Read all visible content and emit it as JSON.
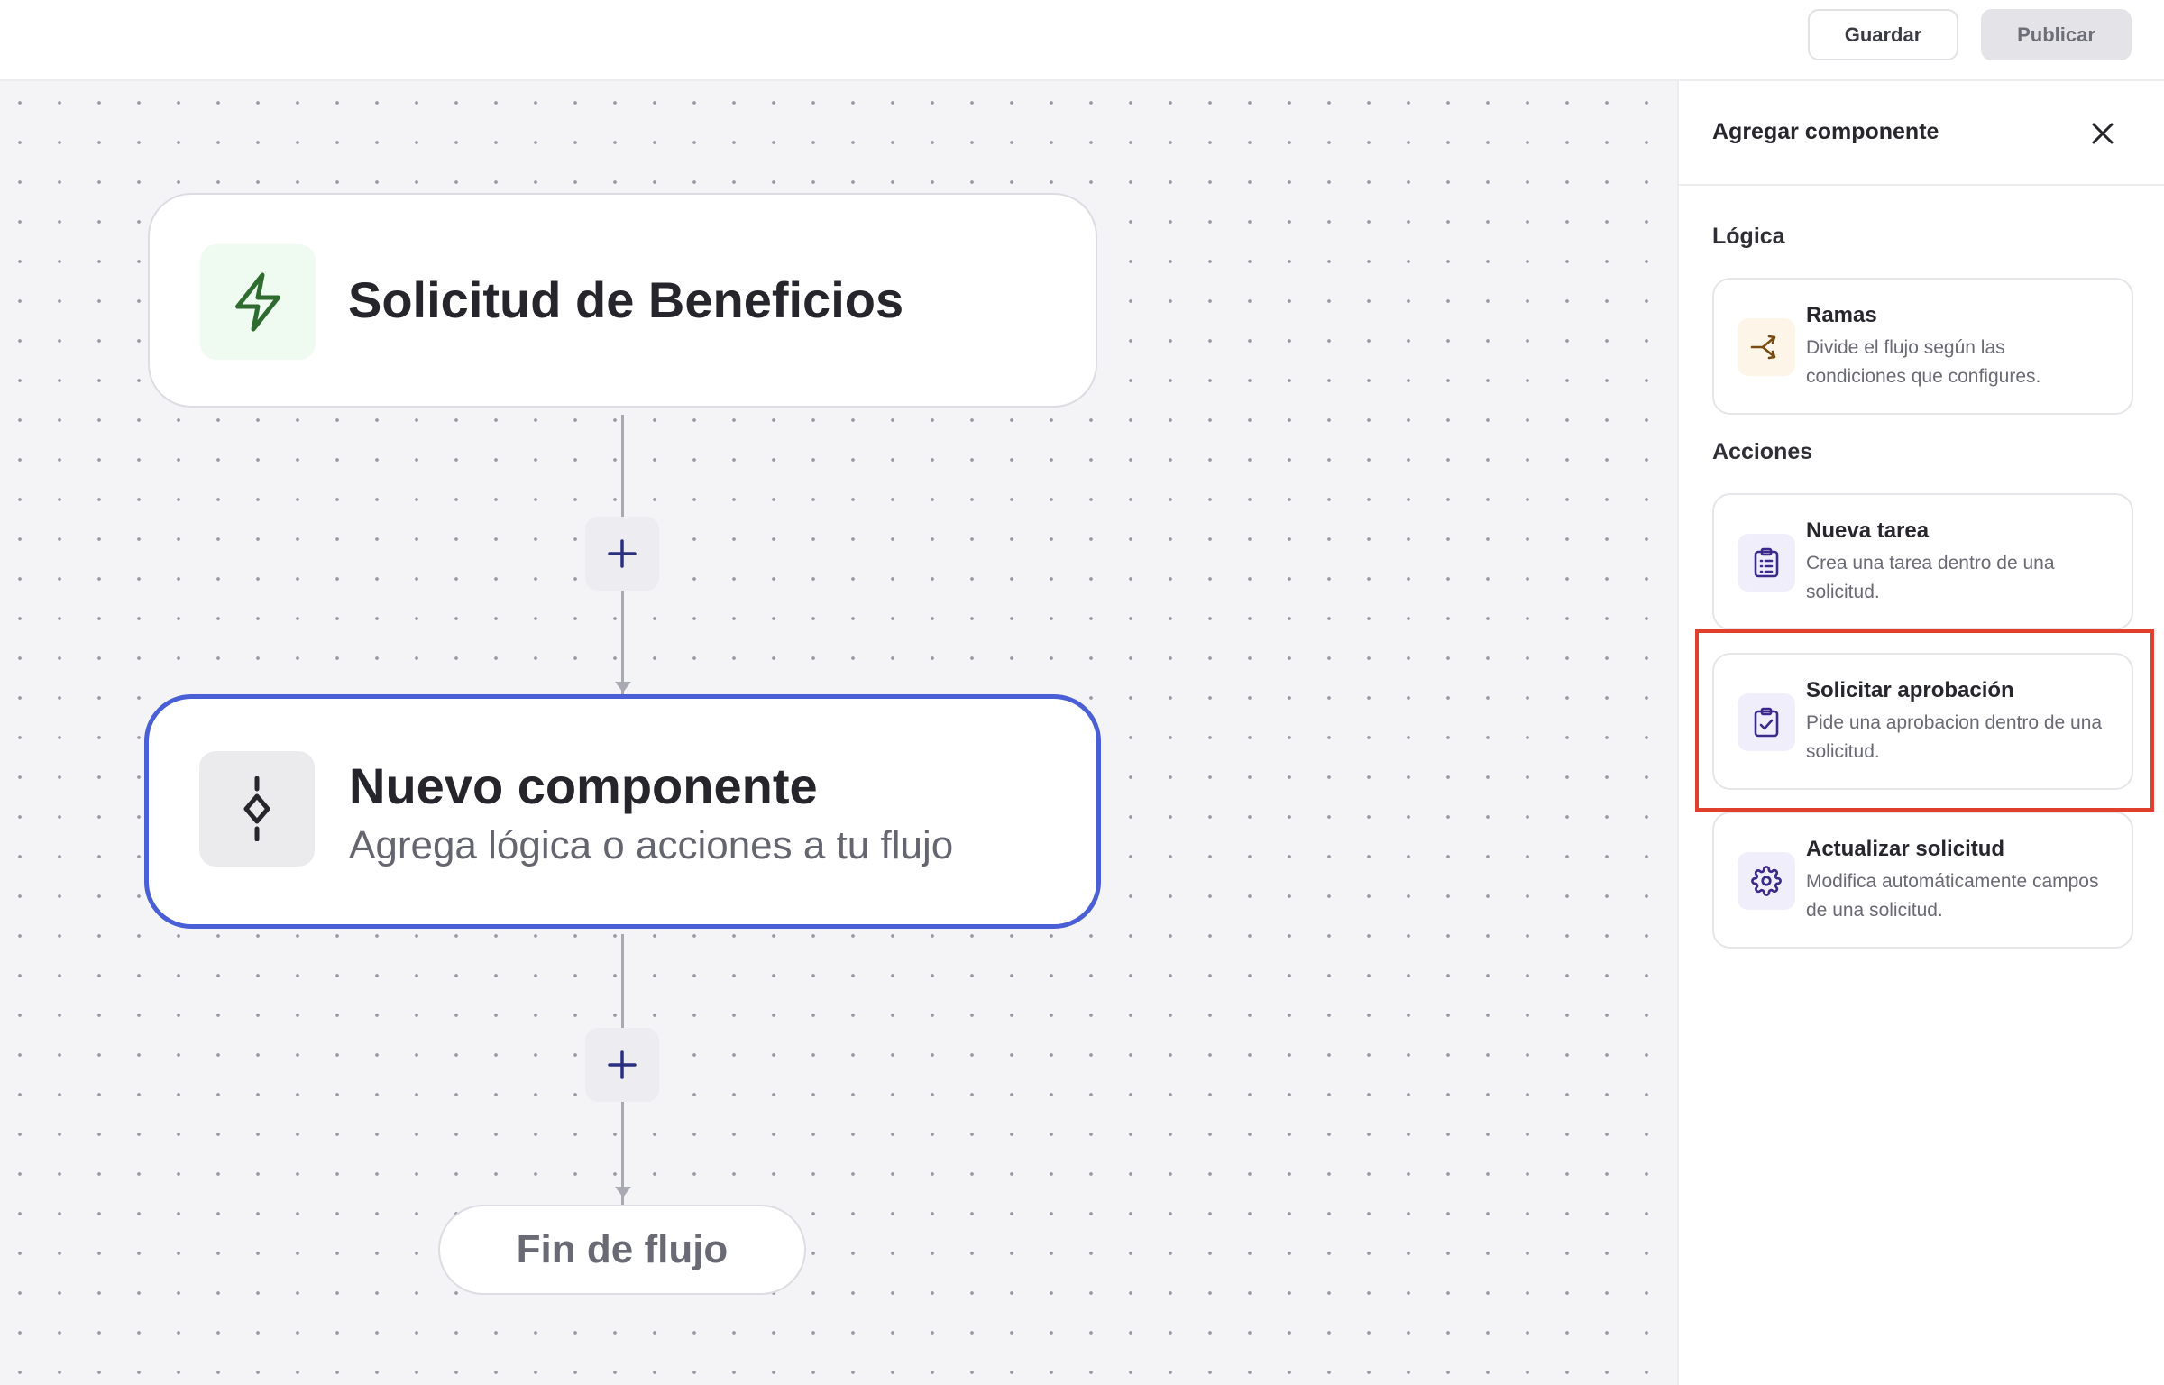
{
  "toolbar": {
    "save_label": "Guardar",
    "publish_label": "Publicar"
  },
  "canvas": {
    "trigger_node": {
      "title": "Solicitud de Beneficios",
      "icon": "lightning-icon"
    },
    "new_node": {
      "title": "Nuevo componente",
      "subtitle": "Agrega lógica o acciones a tu flujo",
      "icon": "diamond-node-icon"
    },
    "end_node": {
      "label": "Fin de flujo"
    },
    "add_step_icon": "plus-icon"
  },
  "panel": {
    "title": "Agregar componente",
    "close_icon": "close-icon",
    "sections": [
      {
        "label": "Lógica",
        "items": [
          {
            "title": "Ramas",
            "description": "Divide el flujo según las condiciones que configures.",
            "icon": "branch-icon",
            "icon_bg": "#fdf5e8",
            "icon_color": "#7a4a12"
          }
        ]
      },
      {
        "label": "Acciones",
        "items": [
          {
            "title": "Nueva tarea",
            "description": "Crea una tarea dentro de una solicitud.",
            "icon": "clipboard-list-icon",
            "icon_bg": "#f1eefb",
            "icon_color": "#3b2a8c"
          },
          {
            "title": "Solicitar aprobación",
            "description": "Pide una aprobacion dentro de una solicitud.",
            "icon": "clipboard-check-icon",
            "icon_bg": "#f1eefb",
            "icon_color": "#3b2a8c",
            "highlighted": true
          },
          {
            "title": "Actualizar solicitud",
            "description": "Modifica automáticamente campos de una solicitud.",
            "icon": "gear-icon",
            "icon_bg": "#f1eefb",
            "icon_color": "#3b2a8c"
          }
        ]
      }
    ]
  },
  "colors": {
    "selected_node_border": "#4a5fd6",
    "highlight_border": "#e0402b",
    "trigger_icon": "#2e6b2f"
  }
}
